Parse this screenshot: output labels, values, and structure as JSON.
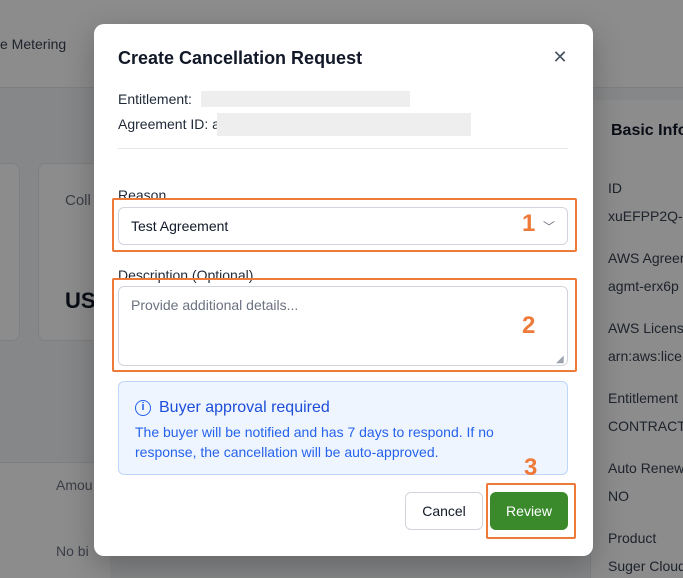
{
  "background": {
    "tab_label": "e Metering",
    "card_title": "Coll",
    "card_value": "US",
    "table_header": "Amou",
    "table_row": "No bi",
    "right_panel": {
      "title": "Basic Info",
      "fields": [
        {
          "label": "ID",
          "value": "xuEFPP2Q-"
        },
        {
          "label": "AWS Agreem",
          "value": "agmt-erx6p"
        },
        {
          "label": "AWS License",
          "value": "arn:aws:lice"
        },
        {
          "label": "Entitlement",
          "value": "CONTRACT"
        },
        {
          "label": "Auto Renew",
          "value": "NO"
        },
        {
          "label": "Product",
          "value": "Suger Cloud"
        }
      ]
    }
  },
  "modal": {
    "title": "Create Cancellation Request",
    "close_icon": "close-icon",
    "entitlement_label": "Entitlement:",
    "agreement_label": "Agreement ID: a",
    "reason": {
      "label": "Reason",
      "selected": "Test Agreement",
      "chevron_icon": "chevron-down-icon"
    },
    "description": {
      "label": "Description (Optional)",
      "placeholder": "Provide additional details..."
    },
    "info": {
      "icon": "info-icon",
      "title": "Buyer approval required",
      "body": "The buyer will be notified and has 7 days to respond. If no response, the cancellation will be auto-approved."
    },
    "buttons": {
      "cancel": "Cancel",
      "review": "Review"
    }
  },
  "annotations": {
    "step1": "1",
    "step2": "2",
    "step3": "3",
    "color": "#ee7a3a"
  }
}
